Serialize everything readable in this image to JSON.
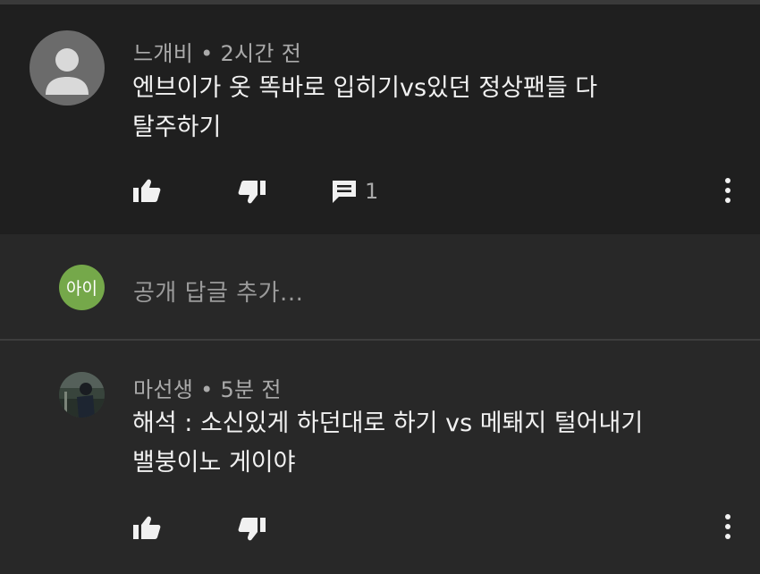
{
  "comments": [
    {
      "author": "느개비",
      "separator": "•",
      "time": "2시간 전",
      "text_line1": "엔브이가 옷 똑바로 입히기vs있던 정상팬들 다",
      "text_line2": "탈주하기",
      "reply_count": "1",
      "icons": [
        "thumbs-up-icon",
        "thumbs-down-icon",
        "reply-icon",
        "more-vert-icon"
      ]
    },
    {
      "author": "마선생",
      "separator": "•",
      "time": "5분 전",
      "text_line1": "해석 : 소신있게 하던대로 하기 vs 메퇘지 털어내기",
      "text_line2": "밸붕이노 게이야",
      "icons": [
        "thumbs-up-icon",
        "thumbs-down-icon",
        "more-vert-icon"
      ]
    }
  ],
  "reply_box": {
    "avatar_text": "아이",
    "placeholder": "공개 답글 추가..."
  },
  "colors": {
    "highlight_bg": "#1f1f1f",
    "page_bg": "#282828",
    "avatar_green": "#75a84a"
  }
}
